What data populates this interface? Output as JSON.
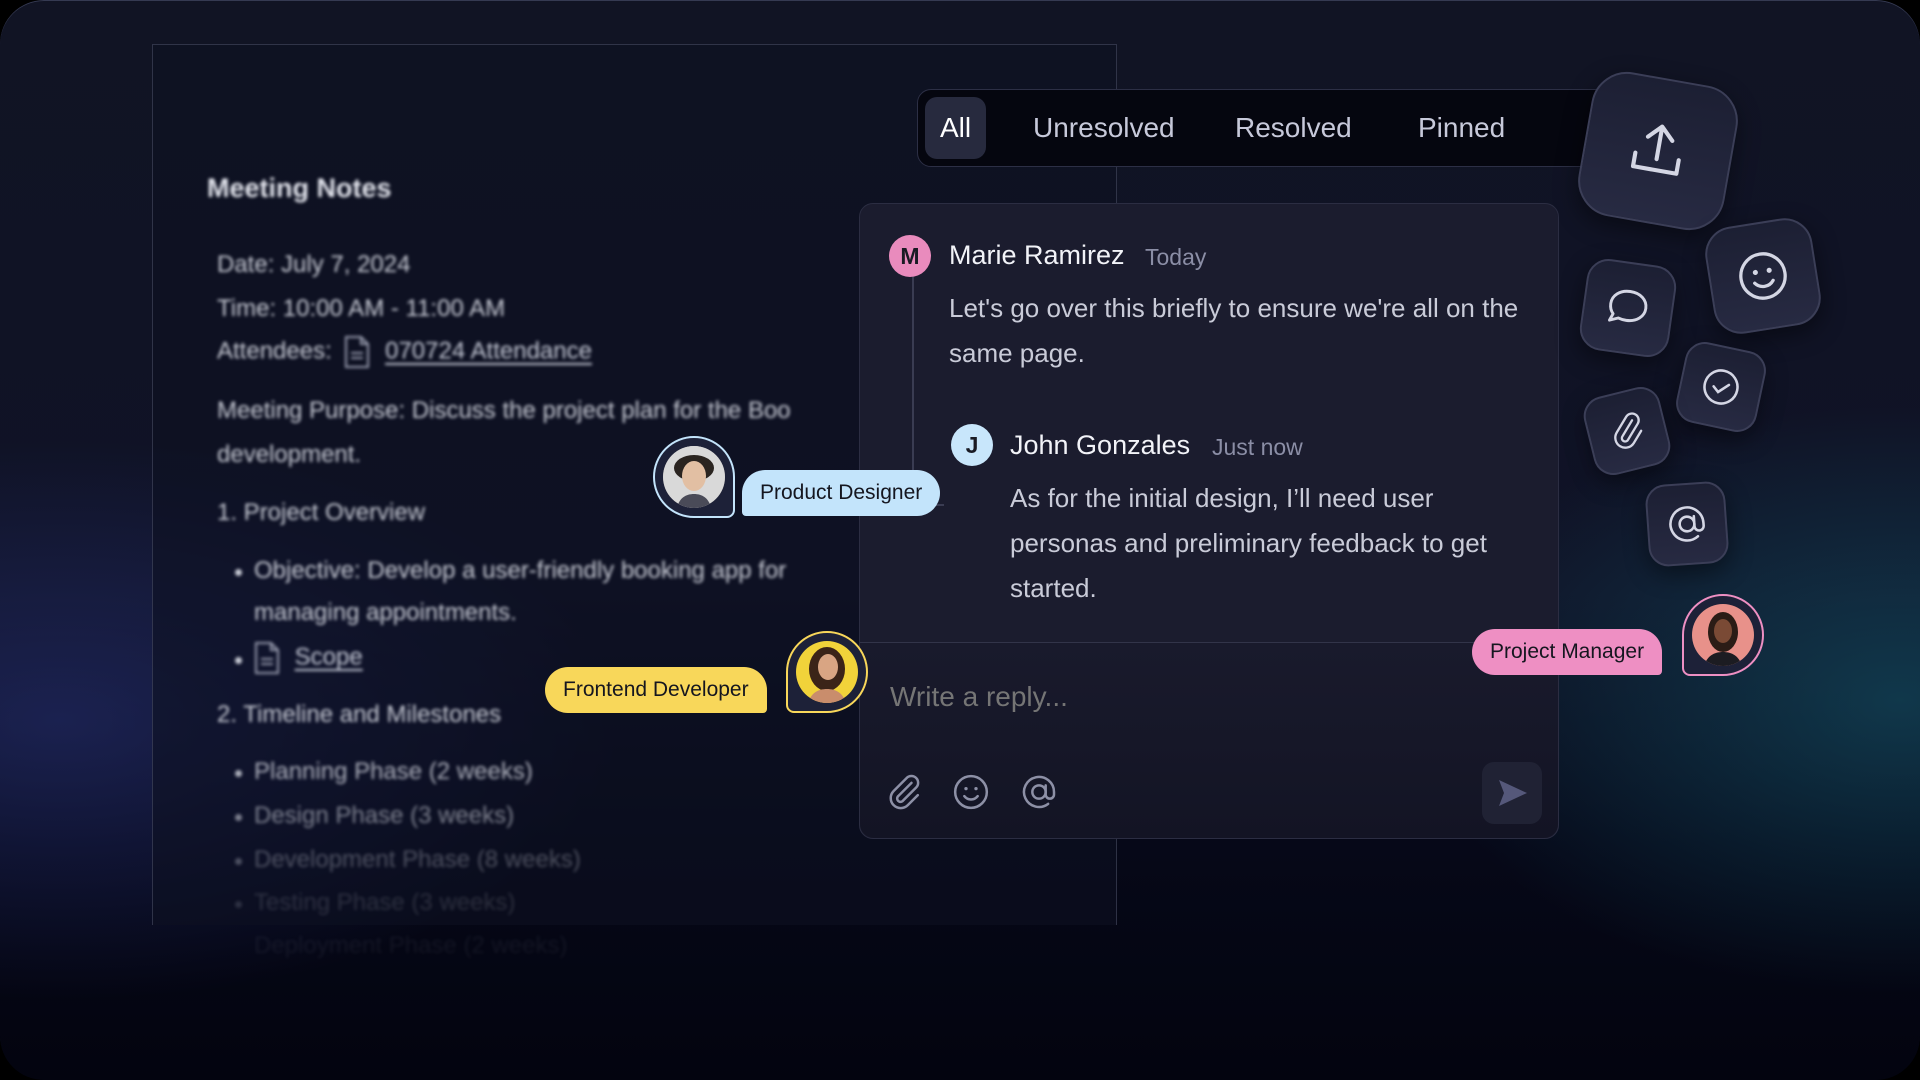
{
  "document": {
    "title": "Meeting Notes",
    "date": "Date: July 7, 2024",
    "time": "Time: 10:00 AM - 11:00 AM",
    "attendees_label": "Attendees:",
    "attendees_link": "070724 Attendance",
    "purpose_line1": "Meeting Purpose: Discuss the project plan for the Boo",
    "purpose_line2": "development.",
    "section1": "1. Project Overview",
    "objective_line1": "Objective: Develop a user-friendly booking app for",
    "objective_line2": "managing appointments.",
    "scope_link": "Scope",
    "section2": "2. Timeline and Milestones",
    "phases": [
      "Planning Phase (2 weeks)",
      "Design Phase (3 weeks)",
      "Development Phase (8 weeks)",
      "Testing Phase (3 weeks)",
      "Deployment Phase (2 weeks)"
    ]
  },
  "filter_tabs": {
    "selected": "All",
    "items": [
      "All",
      "Unresolved",
      "Resolved",
      "Pinned"
    ]
  },
  "comments": [
    {
      "initial": "M",
      "author": "Marie Ramirez",
      "time": "Today",
      "text": "Let's go over this briefly to ensure we're all on the same page.",
      "avatar_color": "#e98bbd"
    },
    {
      "initial": "J",
      "author": "John Gonzales",
      "time": "Just now",
      "text": "As for the initial design, I’ll need user personas and preliminary feedback  to get started.",
      "avatar_color": "#c8e6fb"
    }
  ],
  "reply": {
    "placeholder": "Write a reply...",
    "tools": [
      "paperclip-icon",
      "smiley-icon",
      "at-icon"
    ],
    "send_icon": "send-icon"
  },
  "floating_icons": [
    "upload-icon",
    "smiley-icon",
    "chat-bubble-icon",
    "check-circle-icon",
    "paperclip-icon",
    "at-icon"
  ],
  "collaborators": [
    {
      "role": "Product Designer",
      "color": "#c3e4fb"
    },
    {
      "role": "Frontend Developer",
      "color": "#f8d75a"
    },
    {
      "role": "Project Manager",
      "color": "#ee8fc3"
    }
  ]
}
